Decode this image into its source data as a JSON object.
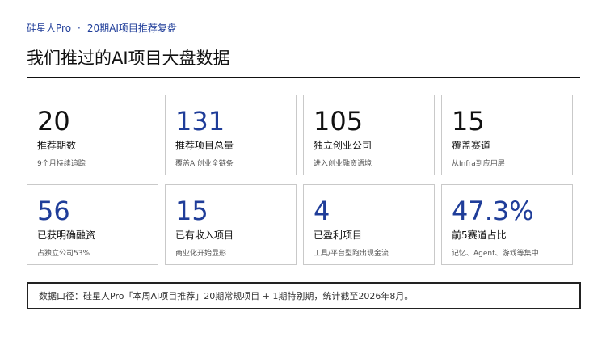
{
  "header": {
    "brand": "硅星人Pro",
    "separator": "·",
    "subtitle": "20期AI项目推荐复盘",
    "title": "我们推过的AI项目大盘数据"
  },
  "stats": [
    {
      "value": "20",
      "label": "推荐期数",
      "sub": "9个月持续追踪",
      "accent": false
    },
    {
      "value": "131",
      "label": "推荐项目总量",
      "sub": "覆盖AI创业全链条",
      "accent": true
    },
    {
      "value": "105",
      "label": "独立创业公司",
      "sub": "进入创业融资语境",
      "accent": false
    },
    {
      "value": "15",
      "label": "覆盖赛道",
      "sub": "从Infra到应用层",
      "accent": false
    },
    {
      "value": "56",
      "label": "已获明确融资",
      "sub": "占独立公司53%",
      "accent": true
    },
    {
      "value": "15",
      "label": "已有收入项目",
      "sub": "商业化开始显形",
      "accent": true
    },
    {
      "value": "4",
      "label": "已盈利项目",
      "sub": "工具/平台型跑出现金流",
      "accent": true
    },
    {
      "value": "47.3%",
      "label": "前5赛道占比",
      "sub": "记忆、Agent、游戏等集中",
      "accent": true
    }
  ],
  "footnote": "数据口径：硅星人Pro「本周AI项目推荐」20期常规项目 + 1期特别期，统计截至2026年8月。",
  "colors": {
    "accent": "#1f3d99",
    "text": "#111111",
    "border": "#c9c9c9"
  }
}
